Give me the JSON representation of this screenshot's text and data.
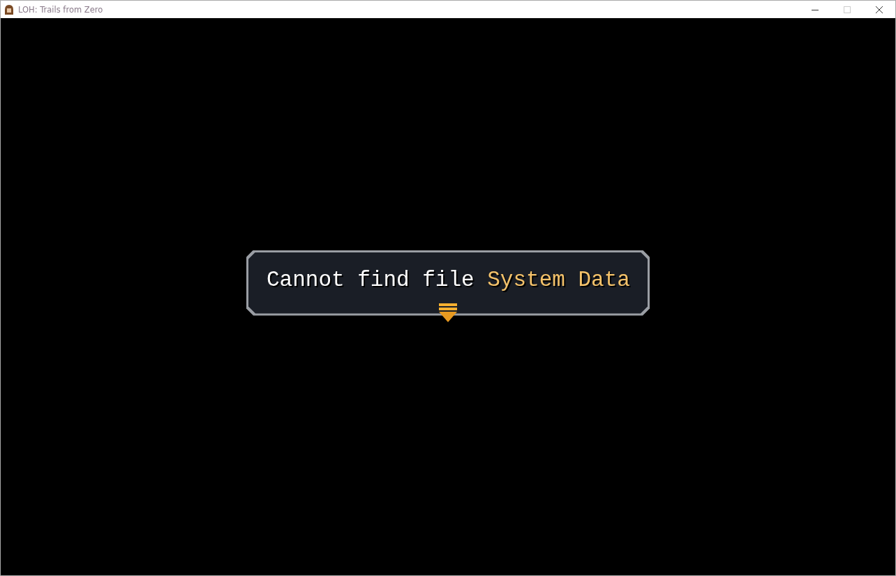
{
  "window": {
    "title": "LOH: Trails from Zero"
  },
  "message": {
    "parts": [
      {
        "text": "Cannot find file ",
        "highlight": false
      },
      {
        "text": "System Data",
        "highlight": true
      }
    ]
  }
}
